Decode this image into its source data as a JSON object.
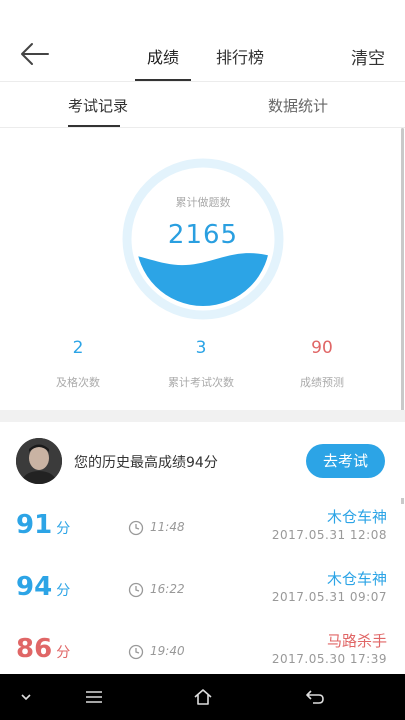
{
  "header": {
    "tabs": [
      {
        "label": "成绩",
        "active": true
      },
      {
        "label": "排行榜",
        "active": false
      }
    ],
    "clear_label": "清空"
  },
  "subtabs": [
    {
      "label": "考试记录",
      "active": true
    },
    {
      "label": "数据统计",
      "active": false
    }
  ],
  "gauge": {
    "label": "累计做题数",
    "value": "2165",
    "fill_fraction": 0.35,
    "color": "#2ca4e6"
  },
  "stats": [
    {
      "value": "2",
      "caption": "及格次数",
      "color": "#2ca4e6"
    },
    {
      "value": "3",
      "caption": "累计考试次数",
      "color": "#2ca4e6"
    },
    {
      "value": "90",
      "caption": "成绩预测",
      "color": "#e06666"
    }
  ],
  "best": {
    "text": "您的历史最高成绩94分",
    "button_label": "去考试"
  },
  "records": [
    {
      "score": "91",
      "unit": "分",
      "duration": "11:48",
      "title": "木仓车神",
      "date": "2017.05.31  12:08",
      "color": "#2ca4e6"
    },
    {
      "score": "94",
      "unit": "分",
      "duration": "16:22",
      "title": "木仓车神",
      "date": "2017.05.31  09:07",
      "color": "#2ca4e6"
    },
    {
      "score": "86",
      "unit": "分",
      "duration": "19:40",
      "title": "马路杀手",
      "date": "2017.05.30  17:39",
      "color": "#e06666"
    }
  ],
  "navbar": {
    "icons": [
      "chevron-down-icon",
      "menu-icon",
      "home-icon",
      "back-icon"
    ]
  }
}
